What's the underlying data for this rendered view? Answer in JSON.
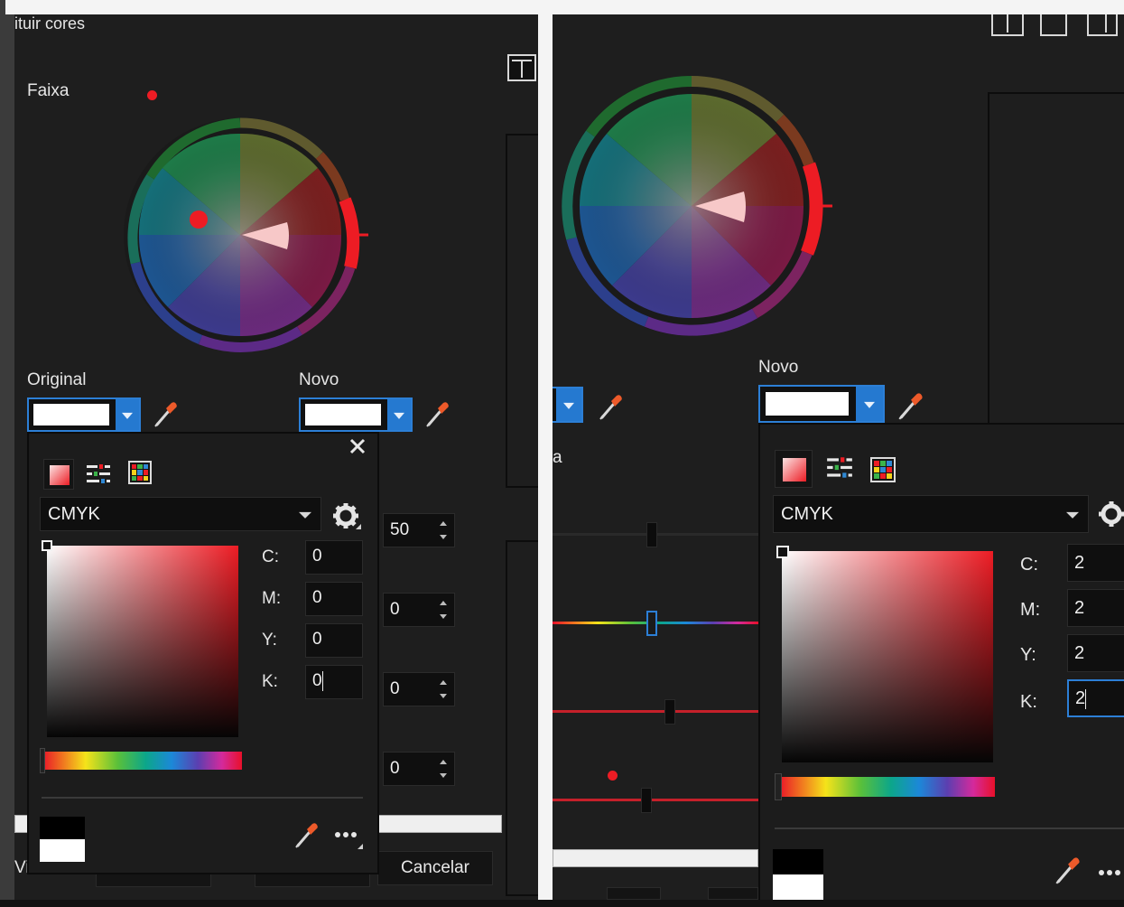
{
  "left": {
    "title": "ituir cores",
    "range_label": "Faixa",
    "original_label": "Original",
    "new_label": "Novo",
    "popup": {
      "model": "CMYK",
      "channels": [
        {
          "label": "C:",
          "value": "0"
        },
        {
          "label": "M:",
          "value": "0"
        },
        {
          "label": "Y:",
          "value": "0"
        },
        {
          "label": "K:",
          "value": "0"
        }
      ]
    },
    "spinners": [
      "50",
      "0",
      "0",
      "0"
    ],
    "cancel_label": "Cancelar",
    "partial_text": "Vi"
  },
  "right": {
    "new_label": "Novo",
    "partial_range_text": "a",
    "popup": {
      "model": "CMYK",
      "channels": [
        {
          "label": "C:",
          "value": "2"
        },
        {
          "label": "M:",
          "value": "2"
        },
        {
          "label": "Y:",
          "value": "2"
        },
        {
          "label": "K:",
          "value": "2"
        }
      ]
    }
  },
  "colors": {
    "accent_blue": "#2579d0",
    "marker_red": "#ed1c24",
    "panel_bg": "#1e1e1e"
  },
  "icons": [
    "close-icon",
    "eyedropper-icon",
    "gear-icon",
    "more-icon",
    "layout-split-icon",
    "gradient-model-icon",
    "sliders-icon",
    "palette-icon"
  ]
}
